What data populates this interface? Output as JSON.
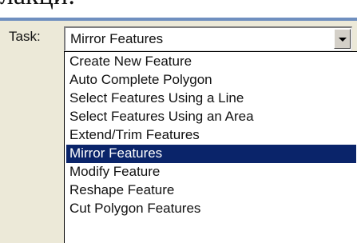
{
  "partial_text": "лакци:",
  "toolbar": {
    "task_label": "Task:",
    "combo_value": "Mirror Features",
    "dropdown_icon": "chevron-down-icon"
  },
  "dropdown": {
    "selected": "Mirror Features",
    "items": [
      "Create New Feature",
      "Auto Complete Polygon",
      "Select Features Using a Line",
      "Select Features Using an Area",
      "Extend/Trim Features",
      "Mirror Features",
      "Modify Feature",
      "Reshape Feature",
      "Cut Polygon Features"
    ]
  },
  "colors": {
    "toolbar_bg": "#ece9d8",
    "selection_bg": "#0a246a",
    "selection_text": "#ffffff"
  }
}
